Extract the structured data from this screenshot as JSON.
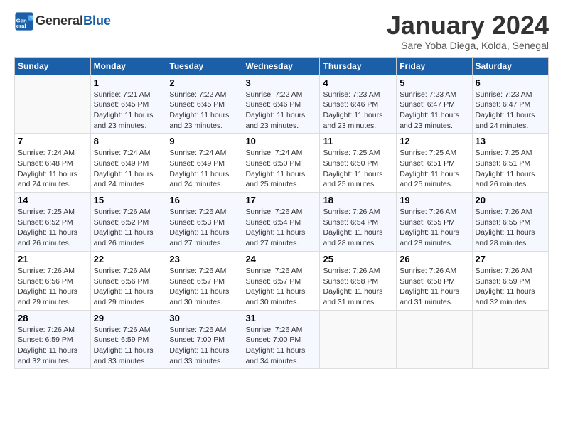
{
  "header": {
    "logo_general": "General",
    "logo_blue": "Blue",
    "month_title": "January 2024",
    "subtitle": "Sare Yoba Diega, Kolda, Senegal"
  },
  "weekdays": [
    "Sunday",
    "Monday",
    "Tuesday",
    "Wednesday",
    "Thursday",
    "Friday",
    "Saturday"
  ],
  "weeks": [
    [
      {
        "day": "",
        "info": ""
      },
      {
        "day": "1",
        "info": "Sunrise: 7:21 AM\nSunset: 6:45 PM\nDaylight: 11 hours\nand 23 minutes."
      },
      {
        "day": "2",
        "info": "Sunrise: 7:22 AM\nSunset: 6:45 PM\nDaylight: 11 hours\nand 23 minutes."
      },
      {
        "day": "3",
        "info": "Sunrise: 7:22 AM\nSunset: 6:46 PM\nDaylight: 11 hours\nand 23 minutes."
      },
      {
        "day": "4",
        "info": "Sunrise: 7:23 AM\nSunset: 6:46 PM\nDaylight: 11 hours\nand 23 minutes."
      },
      {
        "day": "5",
        "info": "Sunrise: 7:23 AM\nSunset: 6:47 PM\nDaylight: 11 hours\nand 23 minutes."
      },
      {
        "day": "6",
        "info": "Sunrise: 7:23 AM\nSunset: 6:47 PM\nDaylight: 11 hours\nand 24 minutes."
      }
    ],
    [
      {
        "day": "7",
        "info": "Sunrise: 7:24 AM\nSunset: 6:48 PM\nDaylight: 11 hours\nand 24 minutes."
      },
      {
        "day": "8",
        "info": "Sunrise: 7:24 AM\nSunset: 6:49 PM\nDaylight: 11 hours\nand 24 minutes."
      },
      {
        "day": "9",
        "info": "Sunrise: 7:24 AM\nSunset: 6:49 PM\nDaylight: 11 hours\nand 24 minutes."
      },
      {
        "day": "10",
        "info": "Sunrise: 7:24 AM\nSunset: 6:50 PM\nDaylight: 11 hours\nand 25 minutes."
      },
      {
        "day": "11",
        "info": "Sunrise: 7:25 AM\nSunset: 6:50 PM\nDaylight: 11 hours\nand 25 minutes."
      },
      {
        "day": "12",
        "info": "Sunrise: 7:25 AM\nSunset: 6:51 PM\nDaylight: 11 hours\nand 25 minutes."
      },
      {
        "day": "13",
        "info": "Sunrise: 7:25 AM\nSunset: 6:51 PM\nDaylight: 11 hours\nand 26 minutes."
      }
    ],
    [
      {
        "day": "14",
        "info": "Sunrise: 7:25 AM\nSunset: 6:52 PM\nDaylight: 11 hours\nand 26 minutes."
      },
      {
        "day": "15",
        "info": "Sunrise: 7:26 AM\nSunset: 6:52 PM\nDaylight: 11 hours\nand 26 minutes."
      },
      {
        "day": "16",
        "info": "Sunrise: 7:26 AM\nSunset: 6:53 PM\nDaylight: 11 hours\nand 27 minutes."
      },
      {
        "day": "17",
        "info": "Sunrise: 7:26 AM\nSunset: 6:54 PM\nDaylight: 11 hours\nand 27 minutes."
      },
      {
        "day": "18",
        "info": "Sunrise: 7:26 AM\nSunset: 6:54 PM\nDaylight: 11 hours\nand 28 minutes."
      },
      {
        "day": "19",
        "info": "Sunrise: 7:26 AM\nSunset: 6:55 PM\nDaylight: 11 hours\nand 28 minutes."
      },
      {
        "day": "20",
        "info": "Sunrise: 7:26 AM\nSunset: 6:55 PM\nDaylight: 11 hours\nand 28 minutes."
      }
    ],
    [
      {
        "day": "21",
        "info": "Sunrise: 7:26 AM\nSunset: 6:56 PM\nDaylight: 11 hours\nand 29 minutes."
      },
      {
        "day": "22",
        "info": "Sunrise: 7:26 AM\nSunset: 6:56 PM\nDaylight: 11 hours\nand 29 minutes."
      },
      {
        "day": "23",
        "info": "Sunrise: 7:26 AM\nSunset: 6:57 PM\nDaylight: 11 hours\nand 30 minutes."
      },
      {
        "day": "24",
        "info": "Sunrise: 7:26 AM\nSunset: 6:57 PM\nDaylight: 11 hours\nand 30 minutes."
      },
      {
        "day": "25",
        "info": "Sunrise: 7:26 AM\nSunset: 6:58 PM\nDaylight: 11 hours\nand 31 minutes."
      },
      {
        "day": "26",
        "info": "Sunrise: 7:26 AM\nSunset: 6:58 PM\nDaylight: 11 hours\nand 31 minutes."
      },
      {
        "day": "27",
        "info": "Sunrise: 7:26 AM\nSunset: 6:59 PM\nDaylight: 11 hours\nand 32 minutes."
      }
    ],
    [
      {
        "day": "28",
        "info": "Sunrise: 7:26 AM\nSunset: 6:59 PM\nDaylight: 11 hours\nand 32 minutes."
      },
      {
        "day": "29",
        "info": "Sunrise: 7:26 AM\nSunset: 6:59 PM\nDaylight: 11 hours\nand 33 minutes."
      },
      {
        "day": "30",
        "info": "Sunrise: 7:26 AM\nSunset: 7:00 PM\nDaylight: 11 hours\nand 33 minutes."
      },
      {
        "day": "31",
        "info": "Sunrise: 7:26 AM\nSunset: 7:00 PM\nDaylight: 11 hours\nand 34 minutes."
      },
      {
        "day": "",
        "info": ""
      },
      {
        "day": "",
        "info": ""
      },
      {
        "day": "",
        "info": ""
      }
    ]
  ]
}
